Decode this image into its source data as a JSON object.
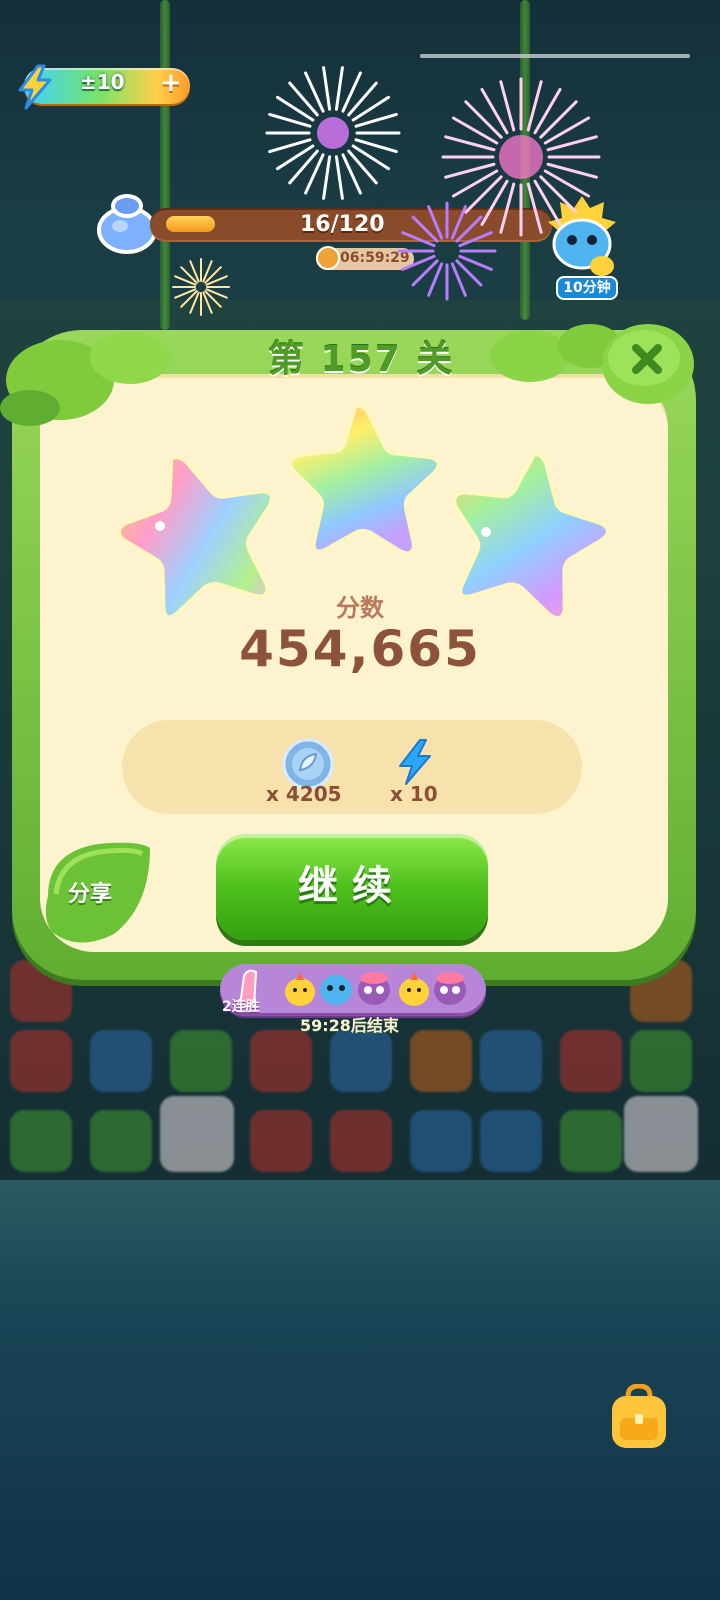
{
  "hud": {
    "energy_value": "±10",
    "energy_plus": "+",
    "level_progress": "16/120",
    "progress_fraction": 0.133,
    "event_timer": "06:59:29",
    "mascot_badge": "10分钟"
  },
  "dialog": {
    "title": "第 157 关",
    "stars_earned": 3,
    "score_label": "分数",
    "score_value": "454,665",
    "rewards": [
      {
        "icon": "leaf-coin-icon",
        "amount": "x 4205"
      },
      {
        "icon": "energy-bolt-icon",
        "amount": "x 10"
      }
    ],
    "continue_label": "继续",
    "share_label": "分享"
  },
  "streak": {
    "label": "2连胜",
    "countdown": "59:28后结束"
  },
  "colors": {
    "leaf_green": "#5fae32",
    "panel_cream": "#fdf3cf",
    "score_brown": "#8c5339",
    "button_green": "#4ec01c",
    "streak_purple": "#b886d8"
  }
}
